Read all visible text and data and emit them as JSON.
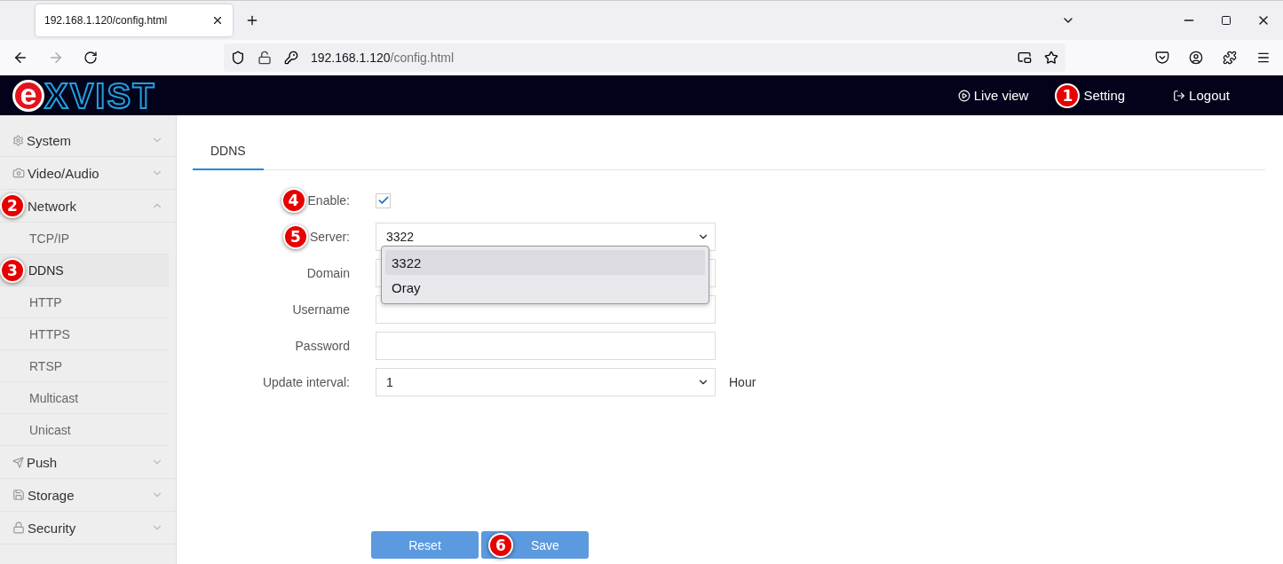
{
  "browser": {
    "tab": {
      "title": "192.168.1.120/config.html"
    },
    "url": {
      "host": "192.168.1.120",
      "path": "/config.html"
    }
  },
  "logo": {
    "mark": "e",
    "text": "XVIST"
  },
  "top_nav": [
    {
      "label": "Live view",
      "kind": "live"
    },
    {
      "label": "Setting",
      "kind": "setting",
      "callout": "1"
    },
    {
      "label": "Logout",
      "kind": "logout"
    }
  ],
  "sidebar": {
    "items": [
      {
        "label": "System",
        "kind": "gear",
        "expanded": false
      },
      {
        "label": "Video/Audio",
        "kind": "camera",
        "expanded": false
      },
      {
        "label": "Network",
        "kind": "plain",
        "expanded": true,
        "callout": "2",
        "children": [
          {
            "label": "TCP/IP",
            "selected": false
          },
          {
            "label": "DDNS",
            "selected": true,
            "callout": "3"
          },
          {
            "label": "HTTP",
            "selected": false
          },
          {
            "label": "HTTPS",
            "selected": false
          },
          {
            "label": "RTSP",
            "selected": false
          },
          {
            "label": "Multicast",
            "selected": false
          },
          {
            "label": "Unicast",
            "selected": false
          }
        ]
      },
      {
        "label": "Push",
        "kind": "send",
        "expanded": false
      },
      {
        "label": "Storage",
        "kind": "disk",
        "expanded": false
      },
      {
        "label": "Security",
        "kind": "lock",
        "expanded": false
      }
    ]
  },
  "tabs": [
    {
      "label": "DDNS",
      "selected": true
    }
  ],
  "form": {
    "fields": [
      {
        "kind": "checkbox",
        "label": "Enable:",
        "checked": true,
        "callout": "4"
      },
      {
        "kind": "select",
        "label": "Server:",
        "value": "3322",
        "callout": "5",
        "expanded": true,
        "options": [
          {
            "label": "3322",
            "selected": true
          },
          {
            "label": "Oray",
            "selected": false
          }
        ]
      },
      {
        "kind": "text",
        "label": "Domain"
      },
      {
        "kind": "text",
        "label": "Username"
      },
      {
        "kind": "password",
        "label": "Password"
      },
      {
        "kind": "select",
        "label": "Update interval:",
        "value": "1",
        "unit": "Hour"
      }
    ]
  },
  "buttons": [
    {
      "label": "Reset"
    },
    {
      "label": "Save",
      "callout": "6"
    }
  ]
}
